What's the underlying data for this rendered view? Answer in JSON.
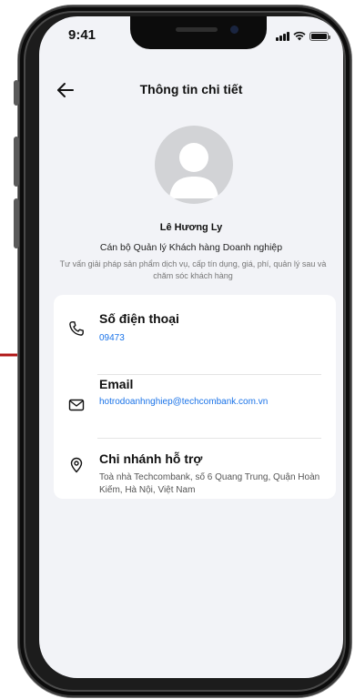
{
  "status_bar": {
    "time": "9:41"
  },
  "header": {
    "title": "Thông tin chi tiết"
  },
  "profile": {
    "name": "Lê Hương Ly",
    "role": "Cán bộ Quản lý Khách hàng Doanh nghiệp",
    "description": "Tư vấn giải pháp sản phẩm dịch vụ, cấp tín dụng, giá, phí, quản lý sau và chăm sóc khách hàng"
  },
  "contact": {
    "phone": {
      "label": "Số điện thoại",
      "value": "09473",
      "icon": "phone-icon"
    },
    "email": {
      "label": "Email",
      "value": "hotrodoanhnghiep@techcombank.com.vn",
      "icon": "mail-icon"
    },
    "branch": {
      "label": "Chi nhánh hỗ trợ",
      "address": "Toà nhà Techcombank, số 6 Quang Trung, Quận Hoàn Kiếm, Hà Nội, Việt Nam",
      "icon": "location-pin-icon"
    }
  },
  "colors": {
    "accent_link": "#1a73e8",
    "annotation_arrow": "#b01515",
    "background": "#f2f3f7"
  }
}
